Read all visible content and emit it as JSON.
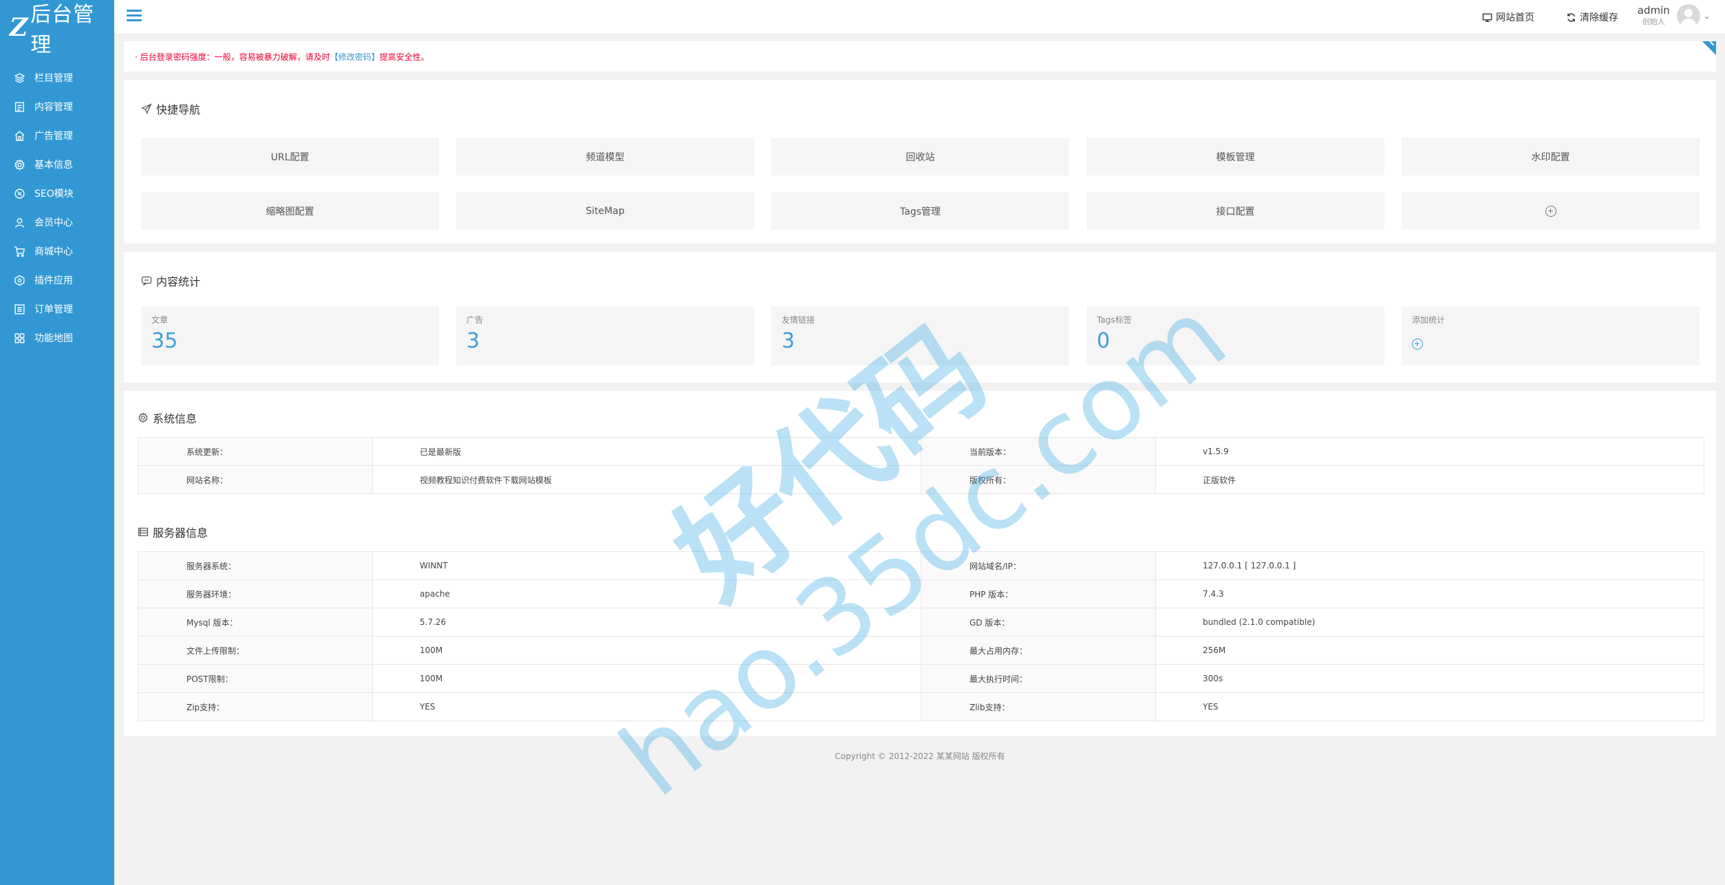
{
  "brand": {
    "mark": "Z",
    "title": "后台管理"
  },
  "sidebar": {
    "items": [
      {
        "label": "栏目管理",
        "icon": "layers-icon"
      },
      {
        "label": "内容管理",
        "icon": "document-icon"
      },
      {
        "label": "广告管理",
        "icon": "home-icon"
      },
      {
        "label": "基本信息",
        "icon": "gear-icon"
      },
      {
        "label": "SEO模块",
        "icon": "seo-icon"
      },
      {
        "label": "会员中心",
        "icon": "user-icon"
      },
      {
        "label": "商城中心",
        "icon": "cart-icon"
      },
      {
        "label": "插件应用",
        "icon": "plugin-icon"
      },
      {
        "label": "订单管理",
        "icon": "list-icon"
      },
      {
        "label": "功能地图",
        "icon": "grid-icon"
      }
    ]
  },
  "header": {
    "site_home": "网站首页",
    "clear_cache": "清除缓存",
    "user_name": "admin",
    "user_role": "创始人"
  },
  "notice": {
    "prefix": "· 后台登录密码强度：一般，容易被暴力破解，请及时",
    "link": "【修改密码】",
    "suffix": "提高安全性。"
  },
  "quick_nav": {
    "title": "快捷导航",
    "items": [
      "URL配置",
      "频道模型",
      "回收站",
      "模板管理",
      "水印配置",
      "缩略图配置",
      "SiteMap",
      "Tags管理",
      "接口配置"
    ]
  },
  "stats": {
    "title": "内容统计",
    "items": [
      {
        "label": "文章",
        "value": "35"
      },
      {
        "label": "广告",
        "value": "3"
      },
      {
        "label": "友情链接",
        "value": "3"
      },
      {
        "label": "Tags标签",
        "value": "0"
      }
    ],
    "add_label": "添加统计"
  },
  "system": {
    "title": "系统信息",
    "rows": [
      {
        "k1": "系统更新：",
        "v1": "已是最新版",
        "k2": "当前版本：",
        "v2": "v1.5.9"
      },
      {
        "k1": "网站名称：",
        "v1": "视频教程知识付费软件下载网站模板",
        "k2": "版权所有：",
        "v2": "正版软件"
      }
    ]
  },
  "server": {
    "title": "服务器信息",
    "rows": [
      {
        "k1": "服务器系统：",
        "v1": "WINNT",
        "k2": "网站域名/IP：",
        "v2": "127.0.0.1 [ 127.0.0.1 ]"
      },
      {
        "k1": "服务器环境：",
        "v1": "apache",
        "k2": "PHP 版本：",
        "v2": "7.4.3"
      },
      {
        "k1": "Mysql 版本：",
        "v1": "5.7.26",
        "k2": "GD 版本：",
        "v2": "bundled (2.1.0 compatible)"
      },
      {
        "k1": "文件上传限制：",
        "v1": "100M",
        "k2": "最大占用内存：",
        "v2": "256M"
      },
      {
        "k1": "POST限制：",
        "v1": "100M",
        "k2": "最大执行时间：",
        "v2": "300s"
      },
      {
        "k1": "Zip支持：",
        "v1": "YES",
        "k2": "Zlib支持：",
        "v2": "YES"
      }
    ]
  },
  "footer": "Copyright © 2012-2022 某某网站 版权所有",
  "watermark": {
    "line1": "好代码",
    "line2": "hao.35dc.com"
  },
  "colors": {
    "primary": "#3298d4",
    "stat_value": "#3aa0d8",
    "warning": "#ee0033"
  }
}
